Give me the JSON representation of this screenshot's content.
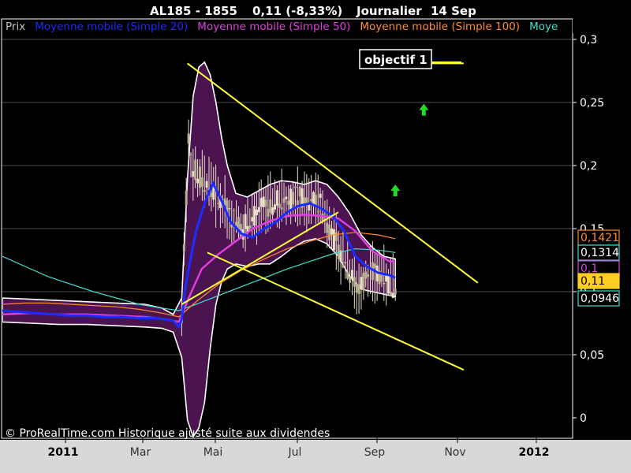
{
  "header": {
    "symbol": "AL185 - 1855",
    "change": "0,11 (-8,33%)",
    "period": "Journalier",
    "date": "14 Sep"
  },
  "legend": [
    {
      "label": "Prix",
      "color": "#c0c0c0"
    },
    {
      "label": "Moyenne mobile (Simple 20)",
      "color": "#1a2cff"
    },
    {
      "label": "Moyenne mobile (Simple 50)",
      "color": "#e040e0"
    },
    {
      "label": "Moyenne mobile (Simple 100)",
      "color": "#ff8c2a"
    },
    {
      "label": "Moye",
      "color": "#40e0d0"
    }
  ],
  "annotation": {
    "label": "objectif 1"
  },
  "footer": {
    "copyright": "© ProRealTime.com Historique ajusté suite aux dividendes"
  },
  "colors": {
    "background": "#000000",
    "plot_border": "#ffffff",
    "band_fill": "#4b1450",
    "band_edge": "#ffffff",
    "trendline": "#ffff33",
    "arrow": "#22dd22",
    "grid": "#666666",
    "axis_text": "#ffffff",
    "xaxis_bg": "#d8d8d8"
  },
  "icons": {
    "up_arrow": "green-up-arrow-icon"
  },
  "chart_data": {
    "type": "line",
    "title": "AL185 - 1855",
    "xlabel": "",
    "ylabel": "",
    "x_ticks": [
      {
        "label": "2011",
        "bold": true
      },
      {
        "label": "Mar",
        "bold": false
      },
      {
        "label": "Mai",
        "bold": false
      },
      {
        "label": "Jul",
        "bold": false
      },
      {
        "label": "Sep",
        "bold": false
      },
      {
        "label": "Nov",
        "bold": false
      },
      {
        "label": "2012",
        "bold": true
      }
    ],
    "y_ticks": [
      "0",
      "0,05",
      "0,1",
      "0,15",
      "0,2",
      "0,25",
      "0,3"
    ],
    "y_tick_values": [
      0,
      0.05,
      0.1,
      0.15,
      0.2,
      0.25,
      0.3
    ],
    "ylim": [
      -0.01,
      0.31
    ],
    "grid": "horizontal",
    "legend_position": "top",
    "right_labels": [
      {
        "text": "0,1421",
        "value": 0.1421,
        "style": "orange"
      },
      {
        "text": "0,1314",
        "value": 0.1314,
        "style": "teal"
      },
      {
        "text": "0,1",
        "value": 0.124,
        "style": "magenta"
      },
      {
        "text": "0,11",
        "value": 0.11,
        "style": "yellow"
      },
      {
        "text": "0,0946",
        "value": 0.0946,
        "style": "teal"
      }
    ],
    "series": [
      {
        "name": "Moyenne mobile (Simple 20)",
        "color": "#1a2cff",
        "points": [
          [
            0.0,
            0.085
          ],
          [
            0.03,
            0.084
          ],
          [
            0.06,
            0.083
          ],
          [
            0.09,
            0.082
          ],
          [
            0.12,
            0.081
          ],
          [
            0.15,
            0.081
          ],
          [
            0.18,
            0.08
          ],
          [
            0.21,
            0.08
          ],
          [
            0.24,
            0.079
          ],
          [
            0.27,
            0.079
          ],
          [
            0.3,
            0.077
          ],
          [
            0.31,
            0.072
          ],
          [
            0.315,
            0.078
          ],
          [
            0.322,
            0.105
          ],
          [
            0.33,
            0.125
          ],
          [
            0.34,
            0.148
          ],
          [
            0.355,
            0.17
          ],
          [
            0.37,
            0.186
          ],
          [
            0.385,
            0.172
          ],
          [
            0.4,
            0.156
          ],
          [
            0.42,
            0.146
          ],
          [
            0.44,
            0.143
          ],
          [
            0.46,
            0.15
          ],
          [
            0.48,
            0.155
          ],
          [
            0.5,
            0.163
          ],
          [
            0.52,
            0.168
          ],
          [
            0.54,
            0.17
          ],
          [
            0.56,
            0.166
          ],
          [
            0.58,
            0.16
          ],
          [
            0.6,
            0.148
          ],
          [
            0.62,
            0.128
          ],
          [
            0.64,
            0.12
          ],
          [
            0.66,
            0.115
          ],
          [
            0.68,
            0.113
          ],
          [
            0.69,
            0.111
          ]
        ]
      },
      {
        "name": "Moyenne mobile (Simple 50)",
        "color": "#e040e0",
        "points": [
          [
            0.0,
            0.082
          ],
          [
            0.05,
            0.083
          ],
          [
            0.1,
            0.082
          ],
          [
            0.15,
            0.082
          ],
          [
            0.2,
            0.081
          ],
          [
            0.25,
            0.08
          ],
          [
            0.29,
            0.078
          ],
          [
            0.31,
            0.076
          ],
          [
            0.33,
            0.098
          ],
          [
            0.35,
            0.118
          ],
          [
            0.38,
            0.13
          ],
          [
            0.41,
            0.14
          ],
          [
            0.44,
            0.15
          ],
          [
            0.47,
            0.156
          ],
          [
            0.5,
            0.16
          ],
          [
            0.53,
            0.161
          ],
          [
            0.56,
            0.16
          ],
          [
            0.59,
            0.158
          ],
          [
            0.62,
            0.148
          ],
          [
            0.65,
            0.132
          ],
          [
            0.68,
            0.124
          ],
          [
            0.69,
            0.124
          ]
        ]
      },
      {
        "name": "Moyenne mobile (Simple 100)",
        "color": "#ff8c2a",
        "points": [
          [
            0.0,
            0.09
          ],
          [
            0.04,
            0.091
          ],
          [
            0.08,
            0.091
          ],
          [
            0.12,
            0.09
          ],
          [
            0.16,
            0.089
          ],
          [
            0.2,
            0.088
          ],
          [
            0.24,
            0.086
          ],
          [
            0.28,
            0.083
          ],
          [
            0.31,
            0.08
          ],
          [
            0.34,
            0.092
          ],
          [
            0.38,
            0.106
          ],
          [
            0.42,
            0.117
          ],
          [
            0.46,
            0.126
          ],
          [
            0.5,
            0.134
          ],
          [
            0.54,
            0.14
          ],
          [
            0.58,
            0.145
          ],
          [
            0.62,
            0.147
          ],
          [
            0.66,
            0.145
          ],
          [
            0.69,
            0.142
          ]
        ]
      },
      {
        "name": "Moye",
        "color": "#40e0d0",
        "points": [
          [
            0.0,
            0.128
          ],
          [
            0.04,
            0.12
          ],
          [
            0.08,
            0.112
          ],
          [
            0.12,
            0.106
          ],
          [
            0.16,
            0.1
          ],
          [
            0.2,
            0.095
          ],
          [
            0.24,
            0.09
          ],
          [
            0.28,
            0.087
          ],
          [
            0.31,
            0.085
          ],
          [
            0.34,
            0.09
          ],
          [
            0.38,
            0.097
          ],
          [
            0.42,
            0.104
          ],
          [
            0.46,
            0.111
          ],
          [
            0.5,
            0.118
          ],
          [
            0.54,
            0.124
          ],
          [
            0.58,
            0.13
          ],
          [
            0.62,
            0.134
          ],
          [
            0.66,
            0.133
          ],
          [
            0.69,
            0.131
          ]
        ]
      }
    ],
    "bollinger_band": {
      "upper": [
        [
          0.0,
          0.095
        ],
        [
          0.05,
          0.094
        ],
        [
          0.1,
          0.093
        ],
        [
          0.15,
          0.092
        ],
        [
          0.2,
          0.091
        ],
        [
          0.25,
          0.09
        ],
        [
          0.28,
          0.087
        ],
        [
          0.3,
          0.082
        ],
        [
          0.315,
          0.095
        ],
        [
          0.325,
          0.19
        ],
        [
          0.335,
          0.255
        ],
        [
          0.345,
          0.278
        ],
        [
          0.355,
          0.282
        ],
        [
          0.365,
          0.272
        ],
        [
          0.375,
          0.25
        ],
        [
          0.385,
          0.222
        ],
        [
          0.395,
          0.2
        ],
        [
          0.41,
          0.178
        ],
        [
          0.43,
          0.175
        ],
        [
          0.45,
          0.18
        ],
        [
          0.47,
          0.185
        ],
        [
          0.49,
          0.188
        ],
        [
          0.51,
          0.187
        ],
        [
          0.53,
          0.185
        ],
        [
          0.55,
          0.188
        ],
        [
          0.57,
          0.185
        ],
        [
          0.59,
          0.175
        ],
        [
          0.61,
          0.162
        ],
        [
          0.63,
          0.145
        ],
        [
          0.65,
          0.135
        ],
        [
          0.67,
          0.128
        ],
        [
          0.69,
          0.126
        ]
      ],
      "lower": [
        [
          0.69,
          0.096
        ],
        [
          0.67,
          0.098
        ],
        [
          0.65,
          0.1
        ],
        [
          0.63,
          0.102
        ],
        [
          0.61,
          0.112
        ],
        [
          0.59,
          0.128
        ],
        [
          0.57,
          0.138
        ],
        [
          0.55,
          0.142
        ],
        [
          0.53,
          0.14
        ],
        [
          0.51,
          0.135
        ],
        [
          0.49,
          0.128
        ],
        [
          0.47,
          0.122
        ],
        [
          0.45,
          0.122
        ],
        [
          0.43,
          0.12
        ],
        [
          0.41,
          0.122
        ],
        [
          0.395,
          0.118
        ],
        [
          0.385,
          0.108
        ],
        [
          0.375,
          0.09
        ],
        [
          0.365,
          0.055
        ],
        [
          0.355,
          0.012
        ],
        [
          0.345,
          -0.008
        ],
        [
          0.335,
          -0.015
        ],
        [
          0.325,
          -0.002
        ],
        [
          0.315,
          0.048
        ],
        [
          0.3,
          0.068
        ],
        [
          0.28,
          0.071
        ],
        [
          0.25,
          0.072
        ],
        [
          0.2,
          0.073
        ],
        [
          0.15,
          0.074
        ],
        [
          0.1,
          0.074
        ],
        [
          0.05,
          0.075
        ],
        [
          0.0,
          0.076
        ]
      ]
    },
    "trendlines": [
      {
        "from": [
          0.325,
          0.281
        ],
        "to": [
          0.835,
          0.107
        ]
      },
      {
        "from": [
          0.315,
          0.09
        ],
        "to": [
          0.59,
          0.163
        ]
      },
      {
        "from": [
          0.36,
          0.131
        ],
        "to": [
          0.81,
          0.038
        ]
      },
      {
        "from": [
          0.75,
          0.281
        ],
        "to": [
          0.81,
          0.281
        ]
      }
    ],
    "signals": [
      {
        "type": "up",
        "at": [
          0.74,
          0.244
        ]
      },
      {
        "type": "up",
        "at": [
          0.69,
          0.18
        ]
      }
    ],
    "price_bars": {
      "start": 0.315,
      "end": 0.69,
      "start_value": 0.083,
      "peak": [
        0.33,
        0.26
      ],
      "end_value": 0.11,
      "low": 0.095,
      "count": 95
    }
  }
}
